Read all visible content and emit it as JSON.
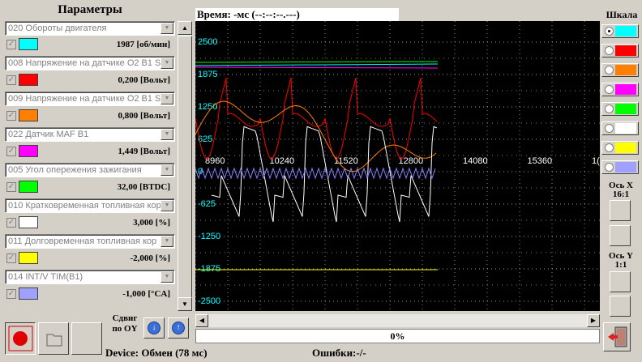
{
  "panel": {
    "title": "Параметры"
  },
  "params": [
    {
      "name": "020 Обороты двигателя",
      "checked": true,
      "color": "#00ffff",
      "value": "1987 [об/мин]"
    },
    {
      "name": "008 Напряжение на датчике O2 B1 S",
      "checked": true,
      "color": "#ff0000",
      "value": "0,200 [Вольт]"
    },
    {
      "name": "009 Напряжение на датчике O2 B1 S",
      "checked": true,
      "color": "#ff8000",
      "value": "0,800 [Вольт]"
    },
    {
      "name": "022 Датчик MAF B1",
      "checked": true,
      "color": "#ff00ff",
      "value": "1,449 [Вольт]"
    },
    {
      "name": "005 Угол опережения зажигания",
      "checked": true,
      "color": "#00ff00",
      "value": "32,00 [BTDC]"
    },
    {
      "name": "010 Кратковременная топливная кор",
      "checked": true,
      "color": "#ffffff",
      "value": "3,000 [%]"
    },
    {
      "name": "011 Долговременная топливная кор",
      "checked": true,
      "color": "#ffff00",
      "value": "-2,000 [%]"
    },
    {
      "name": "014 INT/V TIM(B1)",
      "checked": true,
      "color": "#a0a0ff",
      "value": "-1,000 [°CA]"
    }
  ],
  "time_label": "Время: -мс (--:--:--.---)",
  "chart_data": {
    "type": "line",
    "y_ticks": [
      "2500",
      "1875",
      "1250",
      "625",
      "0",
      "-625",
      "-1250",
      "-1875",
      "-2500"
    ],
    "x_ticks": [
      "8960",
      "10240",
      "11520",
      "12800",
      "14080",
      "15360",
      "1("
    ],
    "ylim": [
      -2500,
      2500
    ],
    "grid": true
  },
  "progress": {
    "value": "0%"
  },
  "scale": {
    "title": "Шкала",
    "items": [
      {
        "color": "#00ffff",
        "selected": true
      },
      {
        "color": "#ff0000",
        "selected": false
      },
      {
        "color": "#ff8000",
        "selected": false
      },
      {
        "color": "#ff00ff",
        "selected": false
      },
      {
        "color": "#00ff00",
        "selected": false
      },
      {
        "color": "#ffffff",
        "selected": false
      },
      {
        "color": "#ffff00",
        "selected": false
      },
      {
        "color": "#a0a0ff",
        "selected": false
      }
    ]
  },
  "axis_x": {
    "label": "Ось X",
    "zoom": "16:1"
  },
  "axis_y": {
    "label": "Ось Y",
    "zoom": "1:1"
  },
  "shift": {
    "label1": "Сдвиг",
    "label2": "по OY"
  },
  "status": {
    "device": "Device:  Обмен (78 мс)",
    "errors": "Ошибки:-/-"
  }
}
